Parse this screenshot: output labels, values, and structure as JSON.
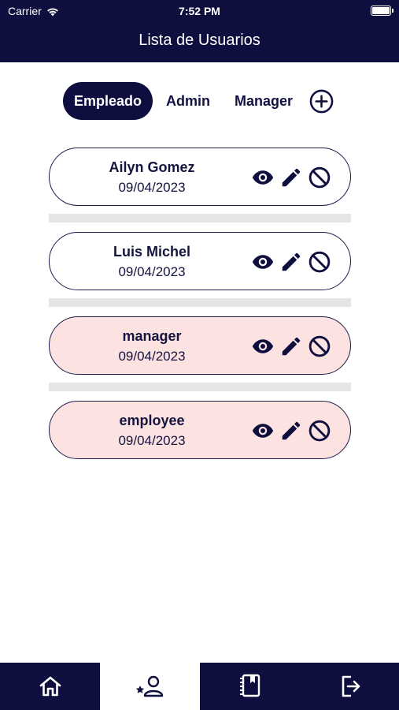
{
  "status_bar": {
    "carrier": "Carrier",
    "time": "7:52 PM"
  },
  "header": {
    "title": "Lista de Usuarios"
  },
  "tabs": [
    {
      "label": "Empleado",
      "active": true
    },
    {
      "label": "Admin",
      "active": false
    },
    {
      "label": "Manager",
      "active": false
    }
  ],
  "users": [
    {
      "name": "Ailyn Gomez",
      "date": "09/04/2023",
      "highlight": false
    },
    {
      "name": "Luis Michel",
      "date": "09/04/2023",
      "highlight": false
    },
    {
      "name": "manager",
      "date": "09/04/2023",
      "highlight": true
    },
    {
      "name": "employee",
      "date": "09/04/2023",
      "highlight": true
    }
  ],
  "card_actions": [
    "eye-icon",
    "pencil-icon",
    "block-icon"
  ],
  "bottom_nav": [
    {
      "icon": "home-icon",
      "active": false
    },
    {
      "icon": "user-star-icon",
      "active": true
    },
    {
      "icon": "book-icon",
      "active": false
    },
    {
      "icon": "logout-icon",
      "active": false
    }
  ],
  "colors": {
    "primary": "#0e0e3f",
    "highlight": "#fde2e2",
    "divider": "#e5e5e5"
  }
}
